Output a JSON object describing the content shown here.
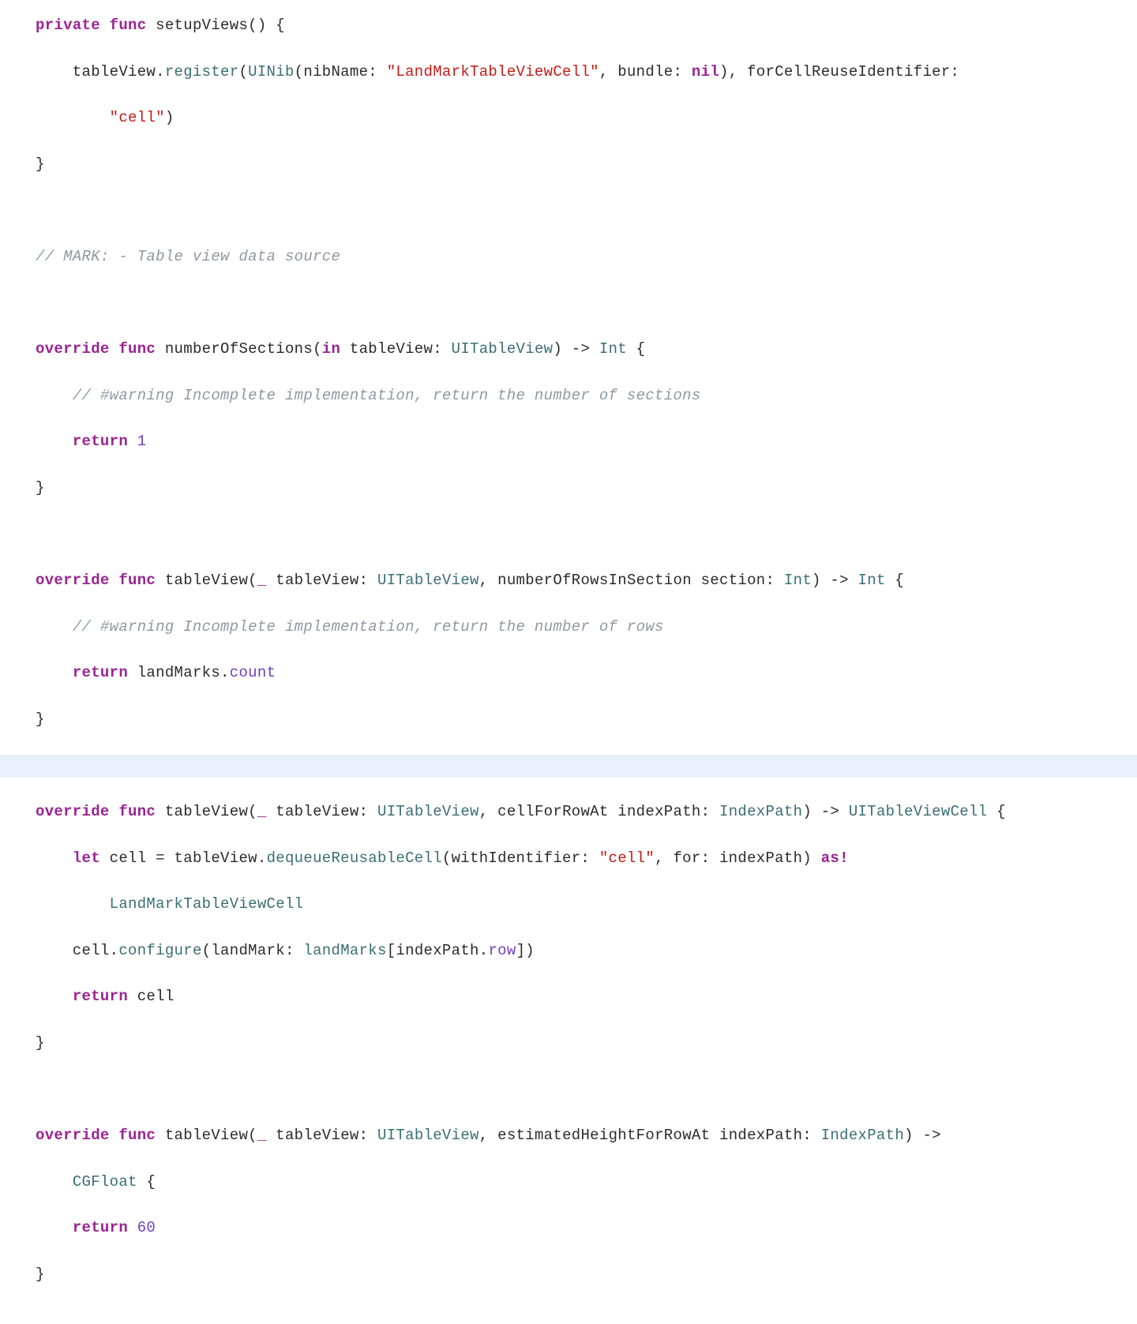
{
  "colors": {
    "keyword": "#9b2393",
    "type": "#3a6e74",
    "string": "#c41a16",
    "number": "#6f42c1",
    "comment": "#8e99a3",
    "highlight_bg": "#e9f0fb"
  },
  "code": {
    "lines": [
      {
        "t": [
          [
            "kw",
            "private"
          ],
          [
            "plain",
            " "
          ],
          [
            "kw",
            "func"
          ],
          [
            "plain",
            " setupViews() {"
          ]
        ]
      },
      {
        "t": [
          [
            "plain",
            "    tableView."
          ],
          [
            "call",
            "register"
          ],
          [
            "plain",
            "("
          ],
          [
            "type",
            "UINib"
          ],
          [
            "plain",
            "(nibName: "
          ],
          [
            "str",
            "\"LandMarkTableViewCell\""
          ],
          [
            "plain",
            ", bundle: "
          ],
          [
            "kw",
            "nil"
          ],
          [
            "plain",
            "), forCellReuseIdentifier:"
          ]
        ]
      },
      {
        "t": [
          [
            "plain",
            "        "
          ],
          [
            "str",
            "\"cell\""
          ],
          [
            "plain",
            ")"
          ]
        ]
      },
      {
        "t": [
          [
            "plain",
            "}"
          ]
        ]
      },
      {
        "t": []
      },
      {
        "t": [
          [
            "comment",
            "// MARK: - Table view data source"
          ]
        ]
      },
      {
        "t": []
      },
      {
        "t": [
          [
            "kw",
            "override"
          ],
          [
            "plain",
            " "
          ],
          [
            "kw",
            "func"
          ],
          [
            "plain",
            " numberOfSections("
          ],
          [
            "kw",
            "in"
          ],
          [
            "plain",
            " tableView: "
          ],
          [
            "type",
            "UITableView"
          ],
          [
            "plain",
            ") -> "
          ],
          [
            "type",
            "Int"
          ],
          [
            "plain",
            " {"
          ]
        ]
      },
      {
        "t": [
          [
            "plain",
            "    "
          ],
          [
            "comment",
            "// #warning Incomplete implementation, return the number of sections"
          ]
        ]
      },
      {
        "t": [
          [
            "plain",
            "    "
          ],
          [
            "kw",
            "return"
          ],
          [
            "plain",
            " "
          ],
          [
            "num",
            "1"
          ]
        ]
      },
      {
        "t": [
          [
            "plain",
            "}"
          ]
        ]
      },
      {
        "t": []
      },
      {
        "t": [
          [
            "kw",
            "override"
          ],
          [
            "plain",
            " "
          ],
          [
            "kw",
            "func"
          ],
          [
            "plain",
            " tableView("
          ],
          [
            "kw",
            "_"
          ],
          [
            "plain",
            " tableView: "
          ],
          [
            "type",
            "UITableView"
          ],
          [
            "plain",
            ", numberOfRowsInSection section: "
          ],
          [
            "type",
            "Int"
          ],
          [
            "plain",
            ") -> "
          ],
          [
            "type",
            "Int"
          ],
          [
            "plain",
            " {"
          ]
        ]
      },
      {
        "t": [
          [
            "plain",
            "    "
          ],
          [
            "comment",
            "// #warning Incomplete implementation, return the number of rows"
          ]
        ]
      },
      {
        "t": [
          [
            "plain",
            "    "
          ],
          [
            "kw",
            "return"
          ],
          [
            "plain",
            " landMarks."
          ],
          [
            "param",
            "count"
          ]
        ]
      },
      {
        "t": [
          [
            "plain",
            "}"
          ]
        ]
      },
      {
        "t": [],
        "hl": true
      },
      {
        "t": [
          [
            "kw",
            "override"
          ],
          [
            "plain",
            " "
          ],
          [
            "kw",
            "func"
          ],
          [
            "plain",
            " tableView("
          ],
          [
            "kw",
            "_"
          ],
          [
            "plain",
            " tableView: "
          ],
          [
            "type",
            "UITableView"
          ],
          [
            "plain",
            ", cellForRowAt indexPath: "
          ],
          [
            "type",
            "IndexPath"
          ],
          [
            "plain",
            ") -> "
          ],
          [
            "type",
            "UITableViewCell"
          ],
          [
            "plain",
            " {"
          ]
        ]
      },
      {
        "t": [
          [
            "plain",
            "    "
          ],
          [
            "kw",
            "let"
          ],
          [
            "plain",
            " cell = tableView."
          ],
          [
            "call",
            "dequeueReusableCell"
          ],
          [
            "plain",
            "(withIdentifier: "
          ],
          [
            "str",
            "\"cell\""
          ],
          [
            "plain",
            ", for: indexPath) "
          ],
          [
            "kw",
            "as!"
          ]
        ]
      },
      {
        "t": [
          [
            "plain",
            "        "
          ],
          [
            "type",
            "LandMarkTableViewCell"
          ]
        ]
      },
      {
        "t": [
          [
            "plain",
            "    cell."
          ],
          [
            "call",
            "configure"
          ],
          [
            "plain",
            "(landMark: "
          ],
          [
            "call",
            "landMarks"
          ],
          [
            "plain",
            "[indexPath."
          ],
          [
            "param",
            "row"
          ],
          [
            "plain",
            "])"
          ]
        ]
      },
      {
        "t": [
          [
            "plain",
            "    "
          ],
          [
            "kw",
            "return"
          ],
          [
            "plain",
            " cell"
          ]
        ]
      },
      {
        "t": [
          [
            "plain",
            "}"
          ]
        ]
      },
      {
        "t": []
      },
      {
        "t": [
          [
            "kw",
            "override"
          ],
          [
            "plain",
            " "
          ],
          [
            "kw",
            "func"
          ],
          [
            "plain",
            " tableView("
          ],
          [
            "kw",
            "_"
          ],
          [
            "plain",
            " tableView: "
          ],
          [
            "type",
            "UITableView"
          ],
          [
            "plain",
            ", estimatedHeightForRowAt indexPath: "
          ],
          [
            "type",
            "IndexPath"
          ],
          [
            "plain",
            ") ->"
          ]
        ]
      },
      {
        "t": [
          [
            "plain",
            "    "
          ],
          [
            "type",
            "CGFloat"
          ],
          [
            "plain",
            " {"
          ]
        ]
      },
      {
        "t": [
          [
            "plain",
            "    "
          ],
          [
            "kw",
            "return"
          ],
          [
            "plain",
            " "
          ],
          [
            "num",
            "60"
          ]
        ]
      },
      {
        "t": [
          [
            "plain",
            "}"
          ]
        ]
      }
    ]
  }
}
